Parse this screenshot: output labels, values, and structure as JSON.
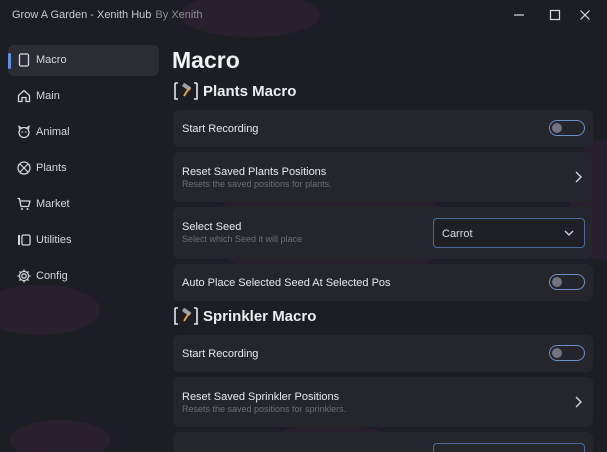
{
  "window": {
    "title": "Grow A Garden - Xenith Hub",
    "subtitle": "By Xenith"
  },
  "sidebar": {
    "items": [
      {
        "label": "Macro",
        "icon": "page-icon",
        "active": true
      },
      {
        "label": "Main",
        "icon": "home-icon",
        "active": false
      },
      {
        "label": "Animal",
        "icon": "animal-icon",
        "active": false
      },
      {
        "label": "Plants",
        "icon": "plants-icon",
        "active": false
      },
      {
        "label": "Market",
        "icon": "cart-icon",
        "active": false
      },
      {
        "label": "Utilities",
        "icon": "utilities-icon",
        "active": false
      },
      {
        "label": "Config",
        "icon": "gear-icon",
        "active": false
      }
    ]
  },
  "main": {
    "title": "Macro",
    "plants_section": {
      "header": "[🔨] Plants Macro",
      "header_text": "Plants Macro",
      "start_recording": {
        "title": "Start Recording",
        "enabled": false
      },
      "reset_positions": {
        "title": "Reset Saved Plants Positions",
        "desc": "Resets the saved positions for plants."
      },
      "select_seed": {
        "title": "Select Seed",
        "desc": "Select which Seed it will place",
        "value": "Carrot"
      },
      "auto_place": {
        "title": "Auto Place Selected Seed At Selected Pos",
        "enabled": false
      }
    },
    "sprinkler_section": {
      "header_text": "Sprinkler Macro",
      "start_recording": {
        "title": "Start Recording",
        "enabled": false
      },
      "reset_positions": {
        "title": "Reset Saved Sprinkler Positions",
        "desc": "Resets the saved positions for sprinklers."
      }
    }
  },
  "colors": {
    "background": "#1d1e23",
    "card": "#25262c",
    "accent": "#5d8fe6"
  }
}
